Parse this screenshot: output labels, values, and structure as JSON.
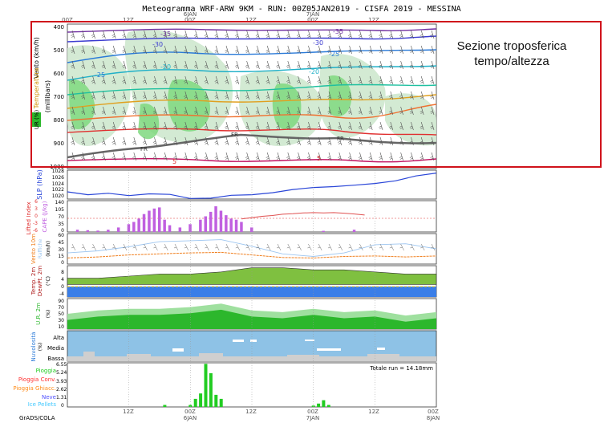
{
  "title": "Meteogramma WRF-ARW 9KM - RUN: 00Z05JAN2019 - CISFA 2019 - MESSINA",
  "annotation": {
    "line1": "Sezione troposferica",
    "line2": "tempo/altezza"
  },
  "credit": "GrADS/COLA",
  "colors": {
    "slp": "#2a46d8",
    "cape": "#c060e0",
    "wind": "#f08020",
    "rh_dark": "#2cb72c",
    "rh_light": "#9fe09f",
    "cloud": "#8ec2e6",
    "rain": "#22cc22",
    "freezing": "#ffd000"
  },
  "time_axis": {
    "top_ticks": [
      "00Z",
      "12Z",
      "00Z",
      "12Z",
      "00Z",
      "12Z"
    ],
    "top_days": [
      "6JAN",
      "7JAN"
    ],
    "bottom_ticks": [
      "12Z",
      "00Z",
      "12Z",
      "00Z",
      "12Z",
      "00Z"
    ],
    "bottom_days": [
      "6JAN",
      "7JAN",
      "8JAN"
    ]
  },
  "panels": {
    "upper": {
      "labels": [
        "Vento (km/h)",
        "Temperatura",
        "(millibars)",
        "UR (%)"
      ],
      "pressure_ticks": [
        "400",
        "500",
        "600",
        "700",
        "800",
        "900",
        "1000"
      ],
      "isotherms": [
        "-35",
        "-30",
        "-25",
        "-20",
        "-15",
        "-10",
        "-5",
        "0",
        "5"
      ],
      "freezing_labels": [
        "FR",
        "FR",
        "FR"
      ]
    },
    "slp": {
      "label": "SLP (hPa)",
      "ticks": [
        "1028",
        "1026",
        "1024",
        "1022",
        "1020"
      ]
    },
    "cape": {
      "label_left": "Lifted Index",
      "label_right": "CAPE (J/kg)",
      "ticks_left": [
        "6",
        "3",
        "0",
        "-3",
        "-6"
      ],
      "ticks_right": [
        "140",
        "105",
        "70",
        "35",
        "0"
      ]
    },
    "wind10": {
      "label": "Vento 10m",
      "label2": "Raffiche",
      "unit": "(km/h)",
      "ticks": [
        "60",
        "45",
        "30",
        "15",
        "0"
      ]
    },
    "temp2m": {
      "label": "Temp. 2m",
      "label2": "DewPt. 2m",
      "unit": "(°C)",
      "ticks": [
        "8",
        "4",
        "0",
        "-4"
      ]
    },
    "rh2m": {
      "label": "U.R. 2m",
      "unit": "(%)",
      "ticks": [
        "90",
        "70",
        "50",
        "30",
        "10"
      ]
    },
    "clouds": {
      "label": "Nuvolosità",
      "unit": "(%)",
      "levels": [
        "Alta",
        "Media",
        "Bassa"
      ]
    },
    "precip": {
      "legend": [
        "Pioggia",
        "Pioggia Conv.",
        "Pioggia Ghiacc.",
        "Neve",
        "Ice Pellets"
      ],
      "legend_colors": [
        "#22cc22",
        "#ff3030",
        "#ff8c1a",
        "#5050ff",
        "#40c8ff"
      ],
      "total": "Totale run = 14.18mm",
      "ticks": [
        "6.55",
        "5.24",
        "3.93",
        "2.62",
        "1.31",
        "0"
      ]
    }
  },
  "chart_data": {
    "type": "bar",
    "title": "Meteogramma WRF-ARW 9KM - RUN: 00Z05JAN2019 - CISFA 2019 - MESSINA",
    "x_unit": "hours from 00Z05JAN2019",
    "x_range": [
      0,
      72
    ],
    "series_slp": {
      "name": "SLP (hPa)",
      "x": [
        0,
        4,
        8,
        12,
        16,
        20,
        24,
        28,
        32,
        36,
        40,
        44,
        48,
        52,
        56,
        60,
        64,
        68,
        72
      ],
      "values": [
        1021.5,
        1020.5,
        1021,
        1020.2,
        1020.8,
        1020.6,
        1019.2,
        1019.3,
        1020.3,
        1020.5,
        1021.2,
        1022.3,
        1023.0,
        1023.3,
        1023.8,
        1024.4,
        1025.3,
        1027.0,
        1028.0
      ],
      "ylim": [
        1019,
        1029
      ]
    },
    "series_cape": {
      "name": "CAPE (J/kg)",
      "x": [
        2,
        4,
        6,
        8,
        10,
        12,
        13,
        14,
        15,
        16,
        17,
        18,
        19,
        20,
        22,
        24,
        26,
        27,
        28,
        29,
        30,
        31,
        32,
        33,
        34,
        36,
        50,
        56
      ],
      "values": [
        10,
        8,
        6,
        10,
        20,
        35,
        45,
        60,
        80,
        95,
        105,
        110,
        55,
        30,
        20,
        35,
        55,
        70,
        90,
        115,
        95,
        75,
        60,
        55,
        45,
        20,
        5,
        10
      ],
      "ylim": [
        0,
        140
      ]
    },
    "series_li": {
      "name": "Lifted Index",
      "x": [
        34,
        36,
        38,
        40,
        42,
        44,
        46,
        48,
        50,
        52,
        54,
        56,
        58
      ],
      "values": [
        -1,
        -0.5,
        0,
        0.3,
        0.8,
        1.0,
        1.3,
        1.4,
        1.3,
        1.4,
        1.2,
        0.9,
        0.5
      ],
      "ylim": [
        -6,
        6
      ]
    },
    "series_wind10": {
      "name": "Vento 10m",
      "x": [
        0,
        6,
        12,
        18,
        24,
        30,
        36,
        42,
        48,
        54,
        60,
        66,
        72
      ],
      "values": [
        12,
        14,
        18,
        20,
        22,
        23,
        18,
        13,
        12,
        15,
        16,
        14,
        16
      ],
      "ylim": [
        0,
        60
      ]
    },
    "series_gust": {
      "name": "Raffiche",
      "x": [
        0,
        6,
        12,
        18,
        24,
        30,
        36,
        42,
        48,
        54,
        60,
        66,
        72
      ],
      "values": [
        22,
        26,
        34,
        44,
        46,
        48,
        35,
        20,
        15,
        22,
        38,
        40,
        30
      ],
      "ylim": [
        0,
        60
      ]
    },
    "series_temp2m": {
      "name": "Temp. 2m",
      "x": [
        0,
        6,
        12,
        18,
        24,
        30,
        36,
        42,
        48,
        54,
        60,
        66,
        72
      ],
      "values": [
        3,
        3,
        4,
        5,
        5,
        6,
        8,
        8,
        7,
        7,
        6,
        5,
        5
      ],
      "ylim": [
        -6,
        9
      ]
    },
    "series_rh2m": {
      "name": "U.R. 2m",
      "x": [
        0,
        6,
        12,
        18,
        24,
        30,
        36,
        42,
        48,
        54,
        60,
        66,
        72
      ],
      "values": [
        55,
        65,
        70,
        70,
        75,
        85,
        65,
        60,
        70,
        60,
        65,
        50,
        60
      ],
      "ylim": [
        10,
        100
      ]
    },
    "series_precip": {
      "name": "Pioggia",
      "x": [
        19,
        24,
        25,
        26,
        27,
        28,
        29,
        30,
        48,
        49,
        50,
        51
      ],
      "values": [
        0.3,
        0.3,
        1.2,
        2.0,
        6.4,
        5.0,
        1.8,
        1.2,
        0.2,
        0.5,
        1.0,
        0.3
      ],
      "ylim": [
        0,
        6.55
      ]
    },
    "total_precip": 14.18
  }
}
